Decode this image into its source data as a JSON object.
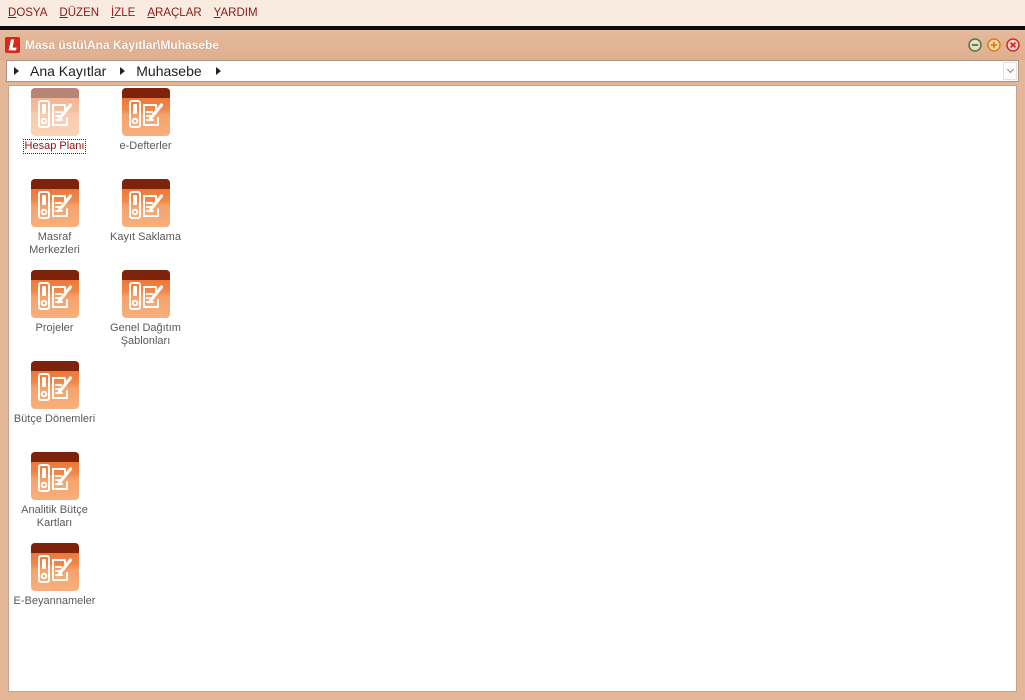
{
  "menu": {
    "items": [
      "DOSYA",
      "DÜZEN",
      "İZLE",
      "ARAÇLAR",
      "YARDIM"
    ]
  },
  "window": {
    "title": "Masa üstü\\Ana Kayıtlar\\Muhasebe",
    "logo_icon": "app-logo-icon",
    "controls": [
      "minimize-icon",
      "maximize-icon",
      "close-icon"
    ]
  },
  "breadcrumb": {
    "items": [
      "Ana Kayıtlar",
      "Muhasebe"
    ],
    "separator_icon": "chevron-right-icon",
    "dropdown_icon": "chevron-down-icon"
  },
  "tiles": [
    {
      "label": "Hesap Planı",
      "icon": "accounting-document-icon",
      "selected": true
    },
    {
      "label": "Masraf Merkezleri",
      "icon": "accounting-document-icon",
      "selected": false
    },
    {
      "label": "Projeler",
      "icon": "accounting-document-icon",
      "selected": false
    },
    {
      "label": "Bütçe Dönemleri",
      "icon": "accounting-document-icon",
      "selected": false
    },
    {
      "label": "Analitik Bütçe Kartları",
      "icon": "accounting-document-icon",
      "selected": false
    },
    {
      "label": "E-Beyannameler",
      "icon": "accounting-document-icon",
      "selected": false
    },
    {
      "label": "e-Defterler",
      "icon": "accounting-document-icon",
      "selected": false
    },
    {
      "label": "Kayıt Saklama",
      "icon": "accounting-document-icon",
      "selected": false
    },
    {
      "label": "Genel Dağıtım Şablonları",
      "icon": "accounting-document-icon",
      "selected": false
    }
  ],
  "colors": {
    "menu_bg": "#f9ebe0",
    "menu_text": "#8c1a12",
    "frame": "#e3b698",
    "title_text": "#ffffff",
    "icon_band": "#7e230b",
    "icon_body": "#f08a4c",
    "label_text": "#5a5a5a",
    "selected_label": "#8b1414"
  }
}
